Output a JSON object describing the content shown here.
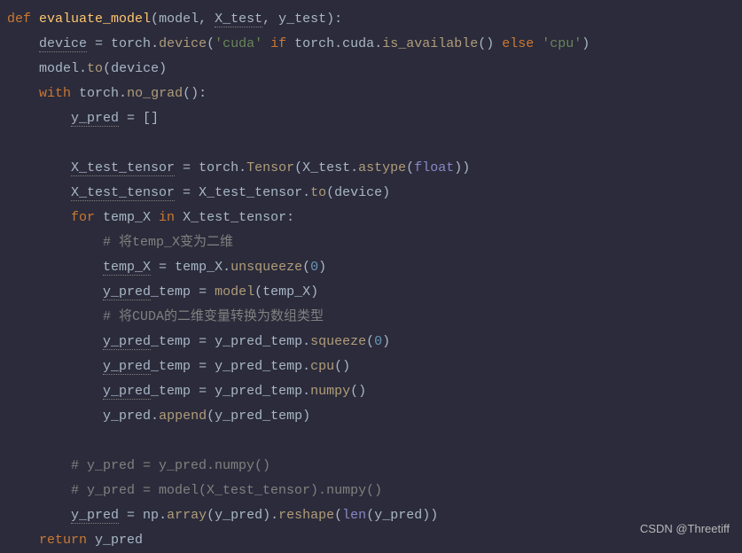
{
  "code": {
    "lines": [
      {
        "indent": 0,
        "tokens": [
          {
            "cls": "kw-def",
            "t": "def "
          },
          {
            "cls": "fn-name",
            "t": "evaluate_model"
          },
          {
            "cls": "punct",
            "t": "("
          },
          {
            "cls": "param",
            "t": "model"
          },
          {
            "cls": "punct",
            "t": ", "
          },
          {
            "cls": "param-underline",
            "t": "X_test"
          },
          {
            "cls": "punct",
            "t": ", "
          },
          {
            "cls": "param",
            "t": "y_test"
          },
          {
            "cls": "punct",
            "t": "):"
          }
        ]
      },
      {
        "indent": 1,
        "tokens": [
          {
            "cls": "var-underline",
            "t": "device"
          },
          {
            "cls": "op",
            "t": " = "
          },
          {
            "cls": "ident",
            "t": "torch"
          },
          {
            "cls": "punct",
            "t": "."
          },
          {
            "cls": "method",
            "t": "device"
          },
          {
            "cls": "punct",
            "t": "("
          },
          {
            "cls": "str",
            "t": "'cuda'"
          },
          {
            "cls": "kw-ctrl",
            "t": " if "
          },
          {
            "cls": "ident",
            "t": "torch"
          },
          {
            "cls": "punct",
            "t": "."
          },
          {
            "cls": "ident",
            "t": "cuda"
          },
          {
            "cls": "punct",
            "t": "."
          },
          {
            "cls": "method",
            "t": "is_available"
          },
          {
            "cls": "punct",
            "t": "()"
          },
          {
            "cls": "kw-ctrl",
            "t": " else "
          },
          {
            "cls": "str",
            "t": "'cpu'"
          },
          {
            "cls": "punct",
            "t": ")"
          }
        ]
      },
      {
        "indent": 1,
        "tokens": [
          {
            "cls": "ident",
            "t": "model"
          },
          {
            "cls": "punct",
            "t": "."
          },
          {
            "cls": "method",
            "t": "to"
          },
          {
            "cls": "punct",
            "t": "("
          },
          {
            "cls": "ident",
            "t": "device"
          },
          {
            "cls": "punct",
            "t": ")"
          }
        ]
      },
      {
        "indent": 1,
        "tokens": [
          {
            "cls": "kw-ctrl",
            "t": "with "
          },
          {
            "cls": "ident",
            "t": "torch"
          },
          {
            "cls": "punct",
            "t": "."
          },
          {
            "cls": "method",
            "t": "no_grad"
          },
          {
            "cls": "punct",
            "t": "():"
          }
        ]
      },
      {
        "indent": 2,
        "tokens": [
          {
            "cls": "var-underline",
            "t": "y_pred"
          },
          {
            "cls": "op",
            "t": " = "
          },
          {
            "cls": "punct",
            "t": "[]"
          }
        ]
      },
      {
        "indent": 0,
        "tokens": []
      },
      {
        "indent": 2,
        "tokens": [
          {
            "cls": "var-underline",
            "t": "X_test_tensor"
          },
          {
            "cls": "op",
            "t": " = "
          },
          {
            "cls": "ident",
            "t": "torch"
          },
          {
            "cls": "punct",
            "t": "."
          },
          {
            "cls": "method",
            "t": "Tensor"
          },
          {
            "cls": "punct",
            "t": "("
          },
          {
            "cls": "ident",
            "t": "X_test"
          },
          {
            "cls": "punct",
            "t": "."
          },
          {
            "cls": "method",
            "t": "astype"
          },
          {
            "cls": "punct",
            "t": "("
          },
          {
            "cls": "builtin",
            "t": "float"
          },
          {
            "cls": "punct",
            "t": "))"
          }
        ]
      },
      {
        "indent": 2,
        "tokens": [
          {
            "cls": "var-underline",
            "t": "X_test_tensor"
          },
          {
            "cls": "op",
            "t": " = "
          },
          {
            "cls": "ident",
            "t": "X_test_tensor"
          },
          {
            "cls": "punct",
            "t": "."
          },
          {
            "cls": "method",
            "t": "to"
          },
          {
            "cls": "punct",
            "t": "("
          },
          {
            "cls": "ident",
            "t": "device"
          },
          {
            "cls": "punct",
            "t": ")"
          }
        ]
      },
      {
        "indent": 2,
        "tokens": [
          {
            "cls": "kw-ctrl",
            "t": "for "
          },
          {
            "cls": "ident",
            "t": "temp_X"
          },
          {
            "cls": "kw-ctrl",
            "t": " in "
          },
          {
            "cls": "ident",
            "t": "X_test_tensor"
          },
          {
            "cls": "punct",
            "t": ":"
          }
        ]
      },
      {
        "indent": 3,
        "tokens": [
          {
            "cls": "comment",
            "t": "# 将temp_X变为二维"
          }
        ]
      },
      {
        "indent": 3,
        "tokens": [
          {
            "cls": "var-underline",
            "t": "temp_X"
          },
          {
            "cls": "op",
            "t": " = "
          },
          {
            "cls": "ident",
            "t": "temp_X"
          },
          {
            "cls": "punct",
            "t": "."
          },
          {
            "cls": "method",
            "t": "unsqueeze"
          },
          {
            "cls": "punct",
            "t": "("
          },
          {
            "cls": "num",
            "t": "0"
          },
          {
            "cls": "punct",
            "t": ")"
          }
        ]
      },
      {
        "indent": 3,
        "tokens": [
          {
            "cls": "var-underline",
            "t": "y_pred"
          },
          {
            "cls": "ident",
            "t": "_temp"
          },
          {
            "cls": "op",
            "t": " = "
          },
          {
            "cls": "method",
            "t": "model"
          },
          {
            "cls": "punct",
            "t": "("
          },
          {
            "cls": "ident",
            "t": "temp_X"
          },
          {
            "cls": "punct",
            "t": ")"
          }
        ]
      },
      {
        "indent": 3,
        "tokens": [
          {
            "cls": "comment",
            "t": "# 将CUDA的二维变量转换为数组类型"
          }
        ]
      },
      {
        "indent": 3,
        "tokens": [
          {
            "cls": "var-underline",
            "t": "y_pred"
          },
          {
            "cls": "ident",
            "t": "_temp"
          },
          {
            "cls": "op",
            "t": " = "
          },
          {
            "cls": "ident",
            "t": "y_pred_temp"
          },
          {
            "cls": "punct",
            "t": "."
          },
          {
            "cls": "method",
            "t": "squeeze"
          },
          {
            "cls": "punct",
            "t": "("
          },
          {
            "cls": "num",
            "t": "0"
          },
          {
            "cls": "punct",
            "t": ")"
          }
        ]
      },
      {
        "indent": 3,
        "tokens": [
          {
            "cls": "var-underline",
            "t": "y_pred"
          },
          {
            "cls": "ident",
            "t": "_temp"
          },
          {
            "cls": "op",
            "t": " = "
          },
          {
            "cls": "ident",
            "t": "y_pred_temp"
          },
          {
            "cls": "punct",
            "t": "."
          },
          {
            "cls": "method",
            "t": "cpu"
          },
          {
            "cls": "punct",
            "t": "()"
          }
        ]
      },
      {
        "indent": 3,
        "tokens": [
          {
            "cls": "var-underline",
            "t": "y_pred"
          },
          {
            "cls": "ident",
            "t": "_temp"
          },
          {
            "cls": "op",
            "t": " = "
          },
          {
            "cls": "ident",
            "t": "y_pred_temp"
          },
          {
            "cls": "punct",
            "t": "."
          },
          {
            "cls": "method",
            "t": "numpy"
          },
          {
            "cls": "punct",
            "t": "()"
          }
        ]
      },
      {
        "indent": 3,
        "tokens": [
          {
            "cls": "ident",
            "t": "y_pred"
          },
          {
            "cls": "punct",
            "t": "."
          },
          {
            "cls": "method",
            "t": "append"
          },
          {
            "cls": "punct",
            "t": "("
          },
          {
            "cls": "ident",
            "t": "y_pred_temp"
          },
          {
            "cls": "punct",
            "t": ")"
          }
        ]
      },
      {
        "indent": 0,
        "tokens": []
      },
      {
        "indent": 2,
        "tokens": [
          {
            "cls": "comment",
            "t": "# y_pred = y_pred.numpy()"
          }
        ]
      },
      {
        "indent": 2,
        "tokens": [
          {
            "cls": "comment",
            "t": "# y_pred = model(X_test_tensor).numpy()"
          }
        ]
      },
      {
        "indent": 2,
        "tokens": [
          {
            "cls": "var-underline",
            "t": "y_pred"
          },
          {
            "cls": "op",
            "t": " = "
          },
          {
            "cls": "ident",
            "t": "np"
          },
          {
            "cls": "punct",
            "t": "."
          },
          {
            "cls": "method",
            "t": "array"
          },
          {
            "cls": "punct",
            "t": "("
          },
          {
            "cls": "ident",
            "t": "y_pred"
          },
          {
            "cls": "punct",
            "t": ")."
          },
          {
            "cls": "method",
            "t": "reshape"
          },
          {
            "cls": "punct",
            "t": "("
          },
          {
            "cls": "builtin",
            "t": "len"
          },
          {
            "cls": "punct",
            "t": "("
          },
          {
            "cls": "ident",
            "t": "y_pred"
          },
          {
            "cls": "punct",
            "t": "))"
          }
        ]
      },
      {
        "indent": 1,
        "tokens": [
          {
            "cls": "kw-ctrl",
            "t": "return "
          },
          {
            "cls": "ident",
            "t": "y_pred"
          }
        ]
      }
    ]
  },
  "watermark": "CSDN @Threetiff"
}
